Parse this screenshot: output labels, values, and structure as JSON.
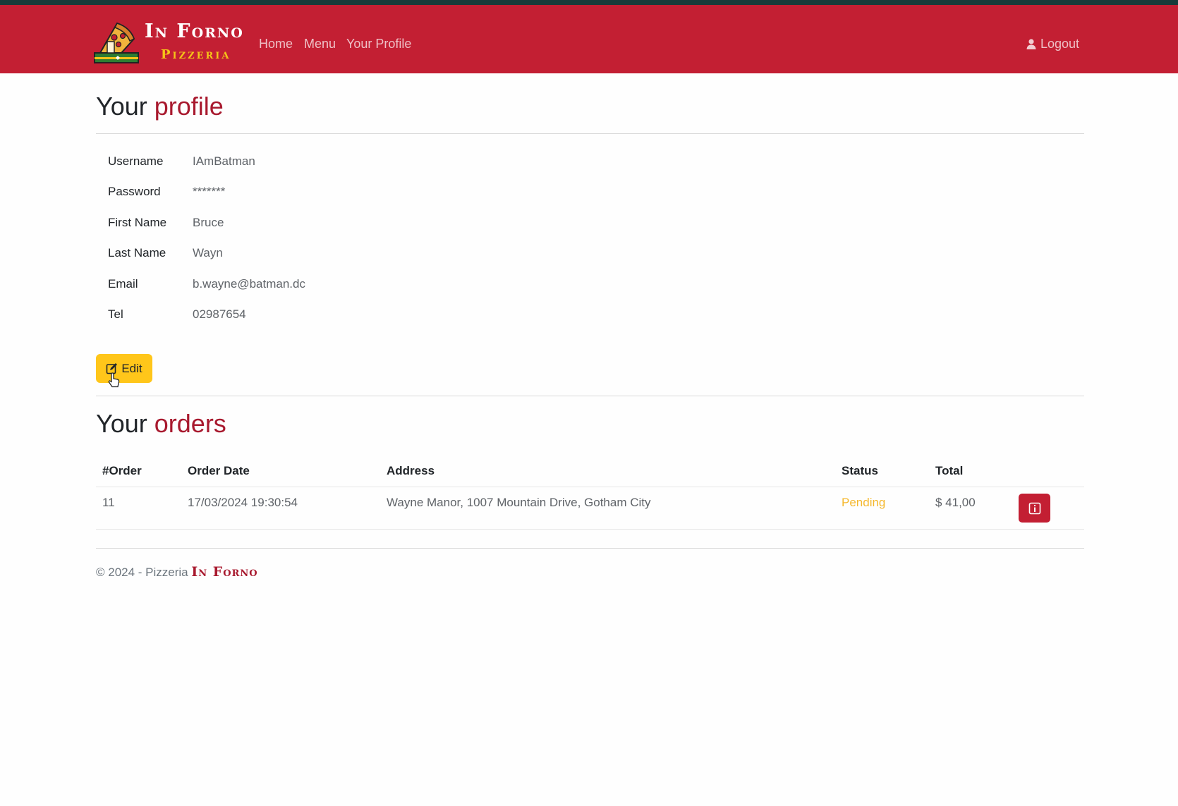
{
  "header": {
    "brand_name": "In Forno",
    "brand_sub": "Pizzeria",
    "nav": [
      "Home",
      "Menu",
      "Your Profile"
    ],
    "logout_label": "Logout"
  },
  "profile": {
    "title_prefix": "Your",
    "title_accent": "profile",
    "fields": [
      {
        "label": "Username",
        "value": "IAmBatman"
      },
      {
        "label": "Password",
        "value": "*******"
      },
      {
        "label": "First Name",
        "value": "Bruce"
      },
      {
        "label": "Last Name",
        "value": "Wayn"
      },
      {
        "label": "Email",
        "value": "b.wayne@batman.dc"
      },
      {
        "label": "Tel",
        "value": "02987654"
      }
    ],
    "edit_label": "Edit"
  },
  "orders": {
    "title_prefix": "Your",
    "title_accent": "orders",
    "columns": [
      "#Order",
      "Order Date",
      "Address",
      "Status",
      "Total"
    ],
    "rows": [
      {
        "order": "11",
        "date": "17/03/2024 19:30:54",
        "address": "Wayne Manor, 1007 Mountain Drive, Gotham City",
        "status": "Pending",
        "total": "$ 41,00"
      }
    ]
  },
  "footer": {
    "text": "© 2024 - Pizzeria",
    "brand": "In Forno"
  },
  "colors": {
    "navbar": "#c31f33",
    "accent": "#a8192e",
    "edit_button": "#ffc61a",
    "pending": "#f5b82e"
  },
  "icons": [
    "pizza-logo-icon",
    "user-icon",
    "edit-icon",
    "info-icon",
    "pointer-cursor-icon"
  ]
}
